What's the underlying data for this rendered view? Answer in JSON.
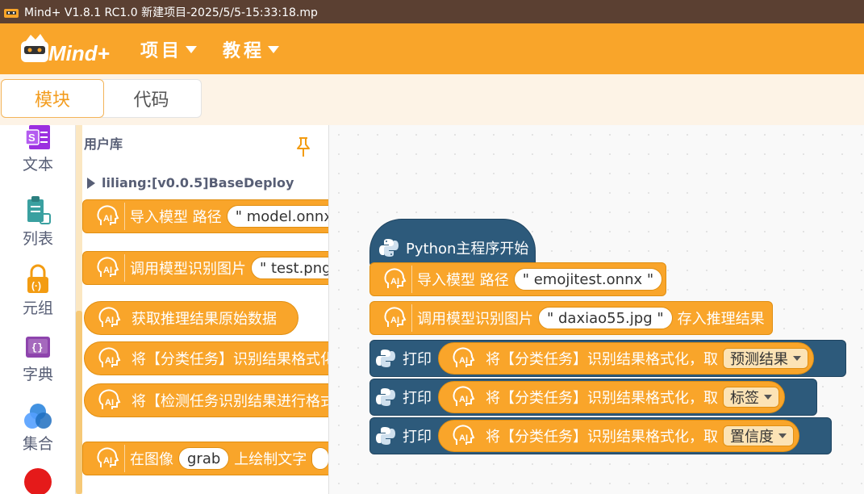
{
  "window": {
    "title": "Mind+ V1.8.1 RC1.0    新建项目-2025/5/5-15:33:18.mp"
  },
  "menubar": {
    "logo_text": "Mind+",
    "items": [
      {
        "label": "项目"
      },
      {
        "label": "教程"
      }
    ]
  },
  "tabs": {
    "blocks": "模块",
    "code": "代码"
  },
  "categories": [
    {
      "label": "文本",
      "icon": "text-icon",
      "color": "#9b2fe0"
    },
    {
      "label": "列表",
      "icon": "list-icon",
      "color": "#3aa0a0"
    },
    {
      "label": "元组",
      "icon": "tuple-lock-icon",
      "color": "#f39c12"
    },
    {
      "label": "字典",
      "icon": "dictionary-book-icon",
      "color": "#8e44ad"
    },
    {
      "label": "集合",
      "icon": "set-circles-icon",
      "color": "#2e86de"
    }
  ],
  "palette": {
    "library_title": "用户库",
    "folder": "liliang:[v0.0.5]BaseDeploy",
    "blocks": [
      {
        "text": "导入模型 路径",
        "slot": "\" model.onnx"
      },
      {
        "text": "调用模型识别图片",
        "slot": "\" test.png"
      },
      {
        "text": "获取推理结果原始数据"
      },
      {
        "text": "将【分类任务】识别结果格式化"
      },
      {
        "text": "将【检测任务识别结果进行格式"
      },
      {
        "text": "在图像",
        "slot": "grab",
        "text2": "上绘制文字"
      }
    ]
  },
  "workspace": {
    "hat": "Python主程序开始",
    "import_block": {
      "text": "导入模型 路径",
      "value": "\" emojitest.onnx \""
    },
    "infer_block": {
      "text": "调用模型识别图片",
      "value": "\" daxiao55.jpg \"",
      "suffix": "存入推理结果"
    },
    "print_label": "打印",
    "format_text": "将【分类任务】识别结果格式化，取",
    "prints": [
      {
        "option": "预测结果"
      },
      {
        "option": "标签"
      },
      {
        "option": "置信度"
      }
    ]
  },
  "colors": {
    "accent": "#f9a52a",
    "python": "#2d5a7b",
    "titlebar": "#5b4032"
  }
}
